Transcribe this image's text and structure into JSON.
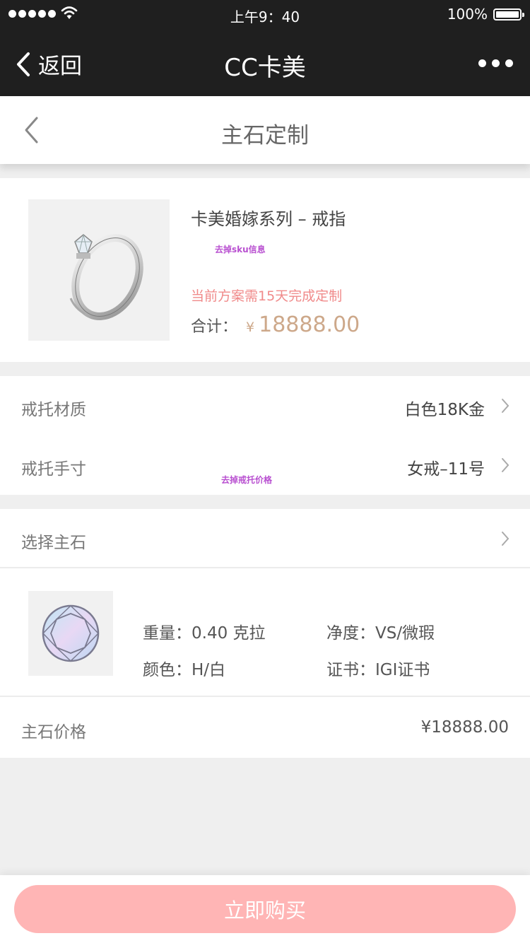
{
  "status_bar": {
    "time": "上午9：40",
    "battery": "100%"
  },
  "app_bar": {
    "back_label": "返回",
    "title": "CC卡美"
  },
  "page_header": {
    "title": "主石定制"
  },
  "product": {
    "name": "卡美婚嫁系列 – 戒指",
    "note": "去掉sku信息",
    "lead_time": "当前方案需15天完成定制",
    "total_label": "合计：",
    "currency": "¥",
    "total": "18888.00"
  },
  "options": [
    {
      "label": "戒托材质",
      "value": "白色18K金"
    },
    {
      "label": "戒托手寸",
      "value": "女戒–11号"
    }
  ],
  "price_note": "去掉戒托价格",
  "stone": {
    "select_label": "选择主石",
    "weight": "重量：0.40 克拉",
    "clarity": "净度：VS/微瑕",
    "color": "颜色：H/白",
    "certificate": "证书：IGI证书",
    "price_label": "主石价格",
    "price": "¥18888.00"
  },
  "buy_button": "立即购买",
  "colors": {
    "top_bar": "#1f1f1f",
    "price_accent": "#cda88a",
    "lead_time_text": "#f08a8a",
    "note_text": "#b84fd0",
    "buy_button": "#ffb5b5"
  },
  "icons": [
    "signal-dots-icon",
    "wifi-icon",
    "battery-icon",
    "back-chevron-icon",
    "more-dots-icon",
    "chevron-left-icon",
    "chevron-right-icon",
    "ring-image",
    "diamond-icon"
  ]
}
